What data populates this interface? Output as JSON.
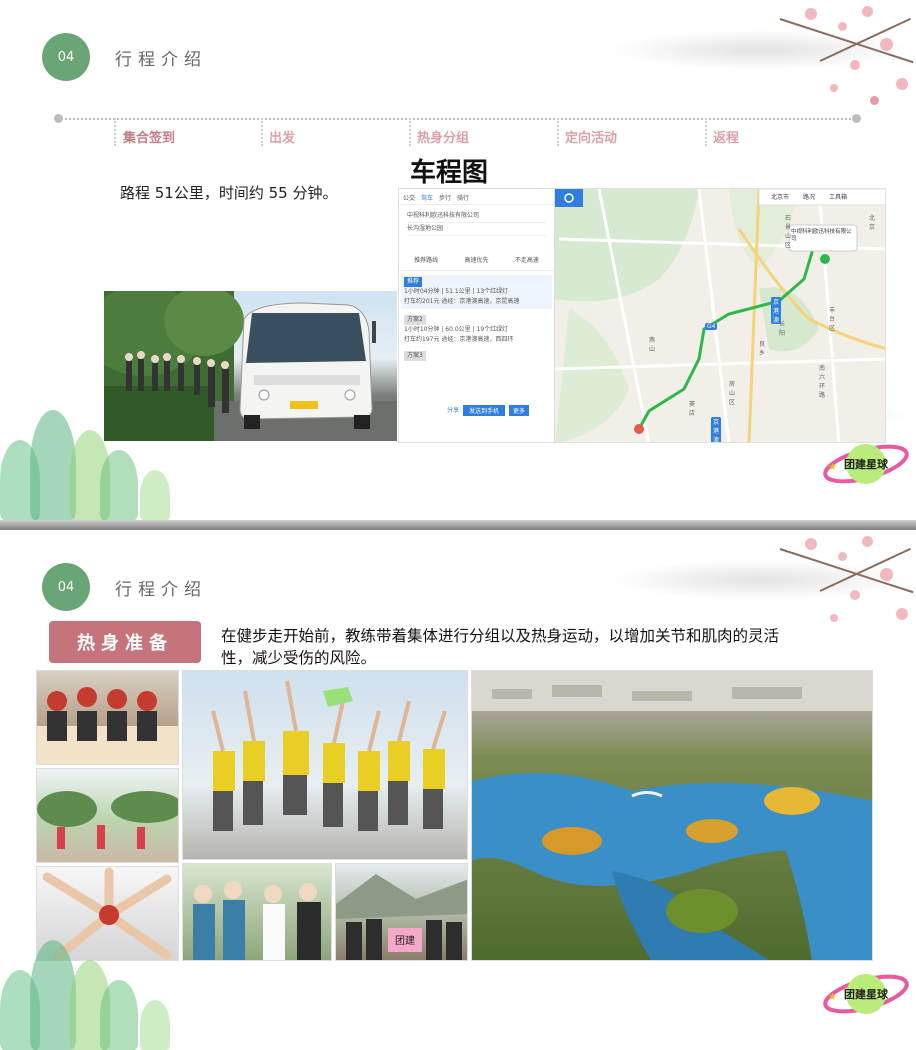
{
  "slide1": {
    "section_number": "04",
    "section_title": "行程介绍",
    "timeline": [
      "集合签到",
      "出发",
      "热身分组",
      "定向活动",
      "返程"
    ],
    "active_step": "集合签到",
    "map_title": "车程图",
    "route_text": "路程 51公里，时间约  55 分钟。",
    "map": {
      "tabs": [
        "公交",
        "驾车",
        "步行",
        "骑行"
      ],
      "origin": "中视科利欧迅科技有限公司",
      "destination": "长沟湿地公园",
      "route_tabs": [
        "推荐路线",
        "高速优先",
        "不走高速"
      ],
      "route1_label": "推荐",
      "route1_time": "1小时04分钟",
      "route1_dist": "51.1公里",
      "route1_lights": "13个红绿灯",
      "route1_detail": "打车约201元  途经：京港澳高速，京昆高速",
      "route2_label": "方案2",
      "route2_time": "1小时10分钟",
      "route2_dist": "60.0公里",
      "route2_lights": "19个红绿灯",
      "route2_detail": "打车约197元  途经：京港澳高速，西四环",
      "route3_label": "方案3",
      "share_label": "分享",
      "send_label": "发送到手机",
      "more_label": "更多",
      "top_right": [
        "北京市",
        "路况",
        "工具箱"
      ],
      "dest_label": "中视科利欧迅科技有限公司",
      "places": [
        "北京",
        "石景山区",
        "丰台区",
        "南六环路",
        "房山区",
        "良乡",
        "长阳",
        "燕山",
        "窦店"
      ],
      "highway_badges": [
        "京港澳",
        "京港澳",
        "G4"
      ]
    },
    "logo_text": "团建星球"
  },
  "slide2": {
    "section_number": "04",
    "section_title": "行程介绍",
    "badge": "热身准备",
    "description": "在健步走开始前，教练带着集体进行分组以及热身运动，以增加关节和肌肉的灵活性，减少受伤的风险。",
    "logo_text": "团建星球",
    "sign_text": "团建"
  },
  "colors": {
    "accent_green": "#6aa575",
    "badge_pink": "#c5747b",
    "timeline_pink": "#dda0a8",
    "route_green": "#2fb84a"
  }
}
